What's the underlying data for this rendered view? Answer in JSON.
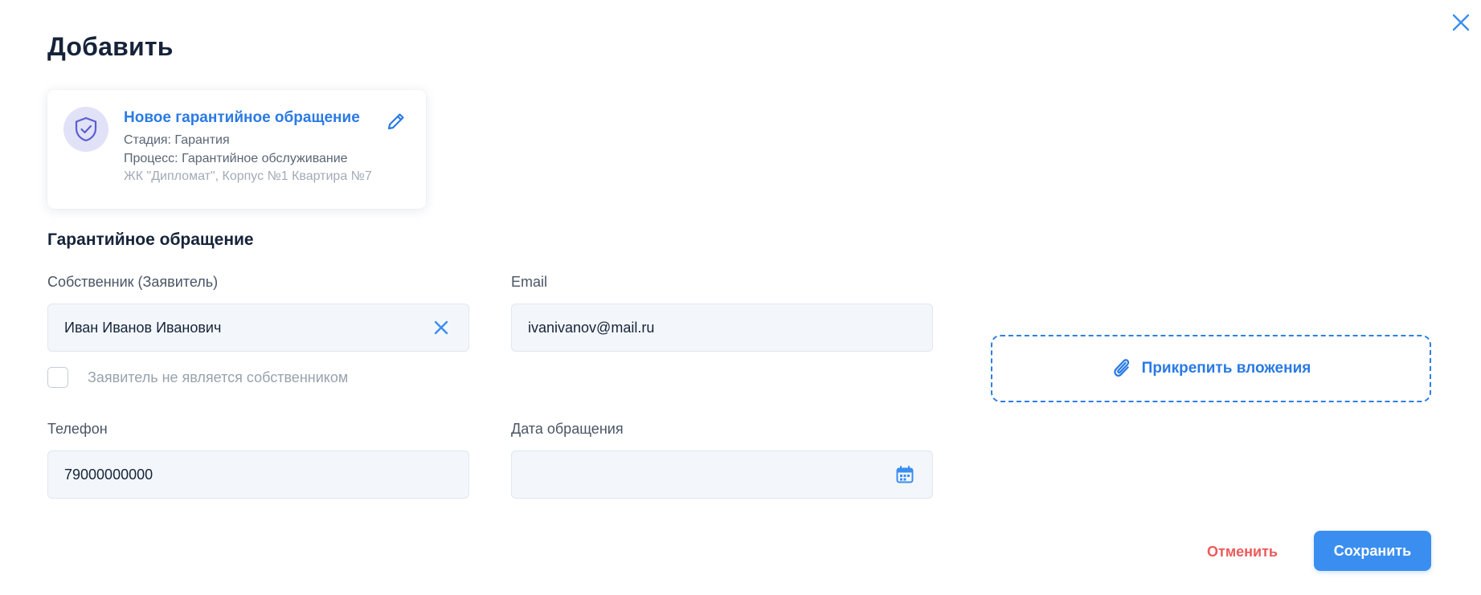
{
  "modal": {
    "title": "Добавить",
    "close_icon": "close-icon"
  },
  "card": {
    "icon": "shield-check-icon",
    "title": "Новое гарантийное обращение",
    "stage": "Стадия: Гарантия",
    "process": "Процесс: Гарантийное обслуживание",
    "address": "ЖК \"Дипломат\", Корпус №1 Квартира №7",
    "edit_icon": "pencil-icon"
  },
  "section": {
    "title": "Гарантийное обращение"
  },
  "form": {
    "owner": {
      "label": "Собственник (Заявитель)",
      "value": "Иван Иванов Иванович",
      "clear_icon": "clear-icon"
    },
    "email": {
      "label": "Email",
      "value": "ivanivanov@mail.ru"
    },
    "not_owner_checkbox": {
      "label": "Заявитель не является собственником",
      "checked": false
    },
    "phone": {
      "label": "Телефон",
      "value": "79000000000"
    },
    "date": {
      "label": "Дата обращения",
      "value": "",
      "calendar_icon": "calendar-icon"
    }
  },
  "attachments": {
    "label": "Прикрепить вложения",
    "icon": "paperclip-icon"
  },
  "actions": {
    "cancel_label": "Отменить",
    "save_label": "Сохранить"
  },
  "colors": {
    "accent": "#3a8ef0",
    "link": "#2a7ae4",
    "danger": "#ec5b5b",
    "title": "#16233a",
    "field_bg": "#f3f7fb",
    "avatar_bg": "#e1e2f7",
    "avatar_icon": "#5b5fd0"
  }
}
